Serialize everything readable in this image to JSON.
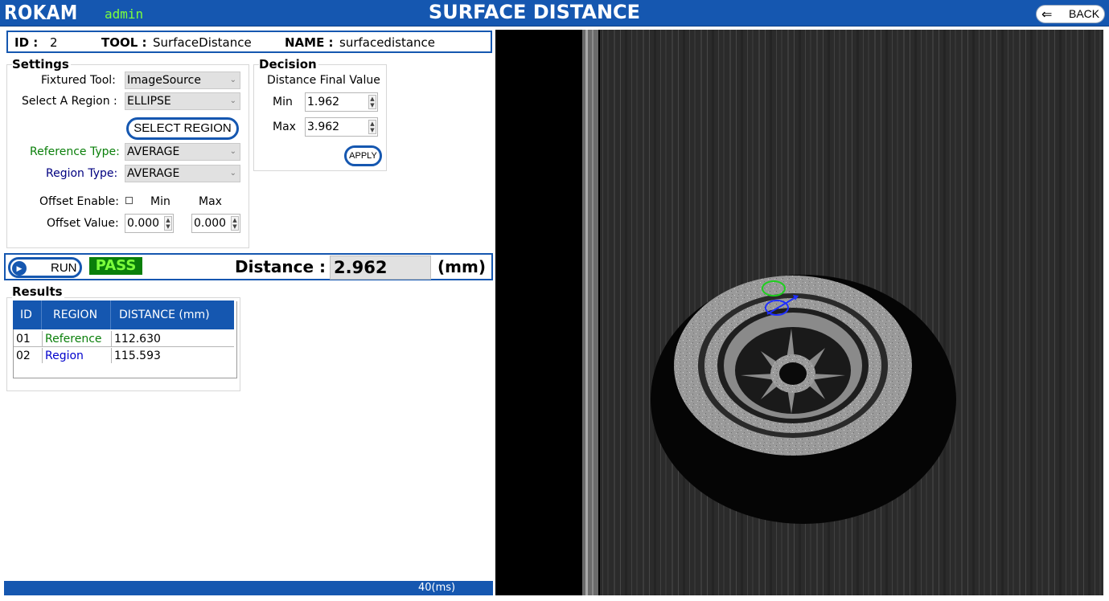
{
  "header": {
    "logo": "ROKAM",
    "user": "admin",
    "title": "SURFACE DISTANCE",
    "back_label": "BACK"
  },
  "tool_info": {
    "id_label": "ID :",
    "id": "2",
    "tool_label": "TOOL :",
    "tool": "SurfaceDistance",
    "name_label": "NAME :",
    "name": "surfacedistance"
  },
  "settings": {
    "title": "Settings",
    "fixtured_tool_label": "Fixtured Tool:",
    "fixtured_tool": "ImageSource",
    "select_region_label": "Select A Region :",
    "select_region": "ELLIPSE",
    "select_region_button": "SELECT REGION",
    "reference_type_label": "Reference Type:",
    "reference_type": "AVERAGE",
    "region_type_label": "Region Type:",
    "region_type": "AVERAGE",
    "offset_enable_label": "Offset Enable:",
    "offset_enabled": false,
    "min_label": "Min",
    "max_label": "Max",
    "offset_value_label": "Offset Value:",
    "offset_min": "0.000",
    "offset_max": "0.000"
  },
  "decision": {
    "title": "Decision",
    "subtitle": "Distance Final Value",
    "min_label": "Min",
    "min": "1.962",
    "max_label": "Max",
    "max": "3.962",
    "apply_label": "APPLY"
  },
  "run": {
    "run_label": "RUN",
    "status": "PASS",
    "distance_label": "Distance :",
    "distance": "2.962",
    "unit": "(mm)"
  },
  "results": {
    "title": "Results",
    "columns": [
      "ID",
      "REGION",
      "DISTANCE (mm)"
    ],
    "rows": [
      {
        "id": "01",
        "region": "Reference",
        "distance": "112.630"
      },
      {
        "id": "02",
        "region": "Region",
        "distance": "115.593"
      }
    ]
  },
  "status_bar": {
    "time": "40(ms)"
  },
  "colors": {
    "accent": "#1557b0",
    "pass_bg": "#0a7f0a",
    "pass_text": "#7cff3c",
    "reference": "#0a7f0a",
    "region": "#0000cc"
  }
}
